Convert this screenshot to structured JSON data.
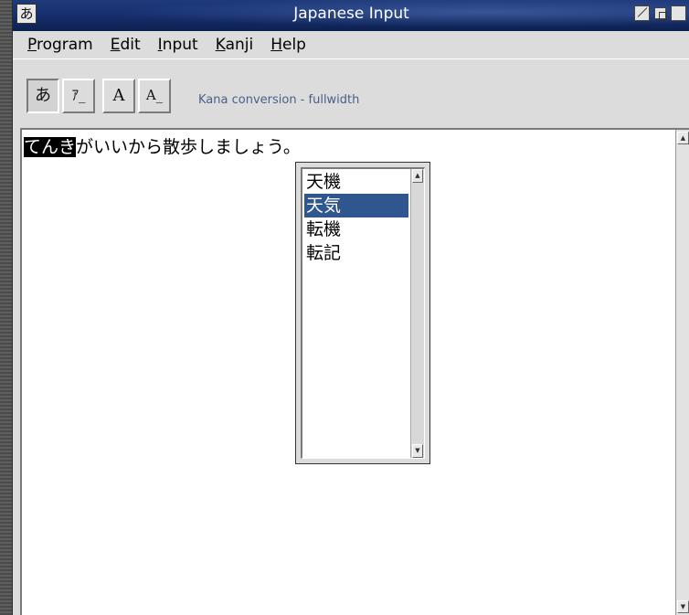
{
  "window": {
    "system_menu_glyph": "あ",
    "title": "Japanese Input",
    "controls": [
      "shade-icon",
      "iconify-icon",
      "maximize-icon"
    ]
  },
  "menubar": {
    "items": [
      {
        "label": "Program",
        "mnemonic": "P",
        "rest": "rogram"
      },
      {
        "label": "Edit",
        "mnemonic": "E",
        "rest": "dit"
      },
      {
        "label": "Input",
        "mnemonic": "I",
        "rest": "nput"
      },
      {
        "label": "Kanji",
        "mnemonic": "K",
        "rest": "anji"
      },
      {
        "label": "Help",
        "mnemonic": "H",
        "rest": "elp"
      }
    ]
  },
  "toolbar": {
    "buttons": [
      {
        "label": "あ",
        "mode": "hiragana",
        "pressed": true
      },
      {
        "label": "ｱ_",
        "mode": "halfwidth-katakana",
        "pressed": false
      },
      {
        "label": "A",
        "mode": "fullwidth-latin",
        "pressed": false
      },
      {
        "label": "A_",
        "mode": "halfwidth-latin",
        "pressed": false
      }
    ],
    "mode_label": "Kana conversion - fullwidth"
  },
  "editor": {
    "preedit_text": "てんき",
    "committed_text": "がいいから散歩しましょう。"
  },
  "candidates": {
    "items": [
      "天機",
      "天気",
      "転機",
      "転記"
    ],
    "selected_index": 1
  },
  "colors": {
    "titlebar": "#163070",
    "selection": "#2f568f",
    "mode_label": "#4a5f8a"
  }
}
